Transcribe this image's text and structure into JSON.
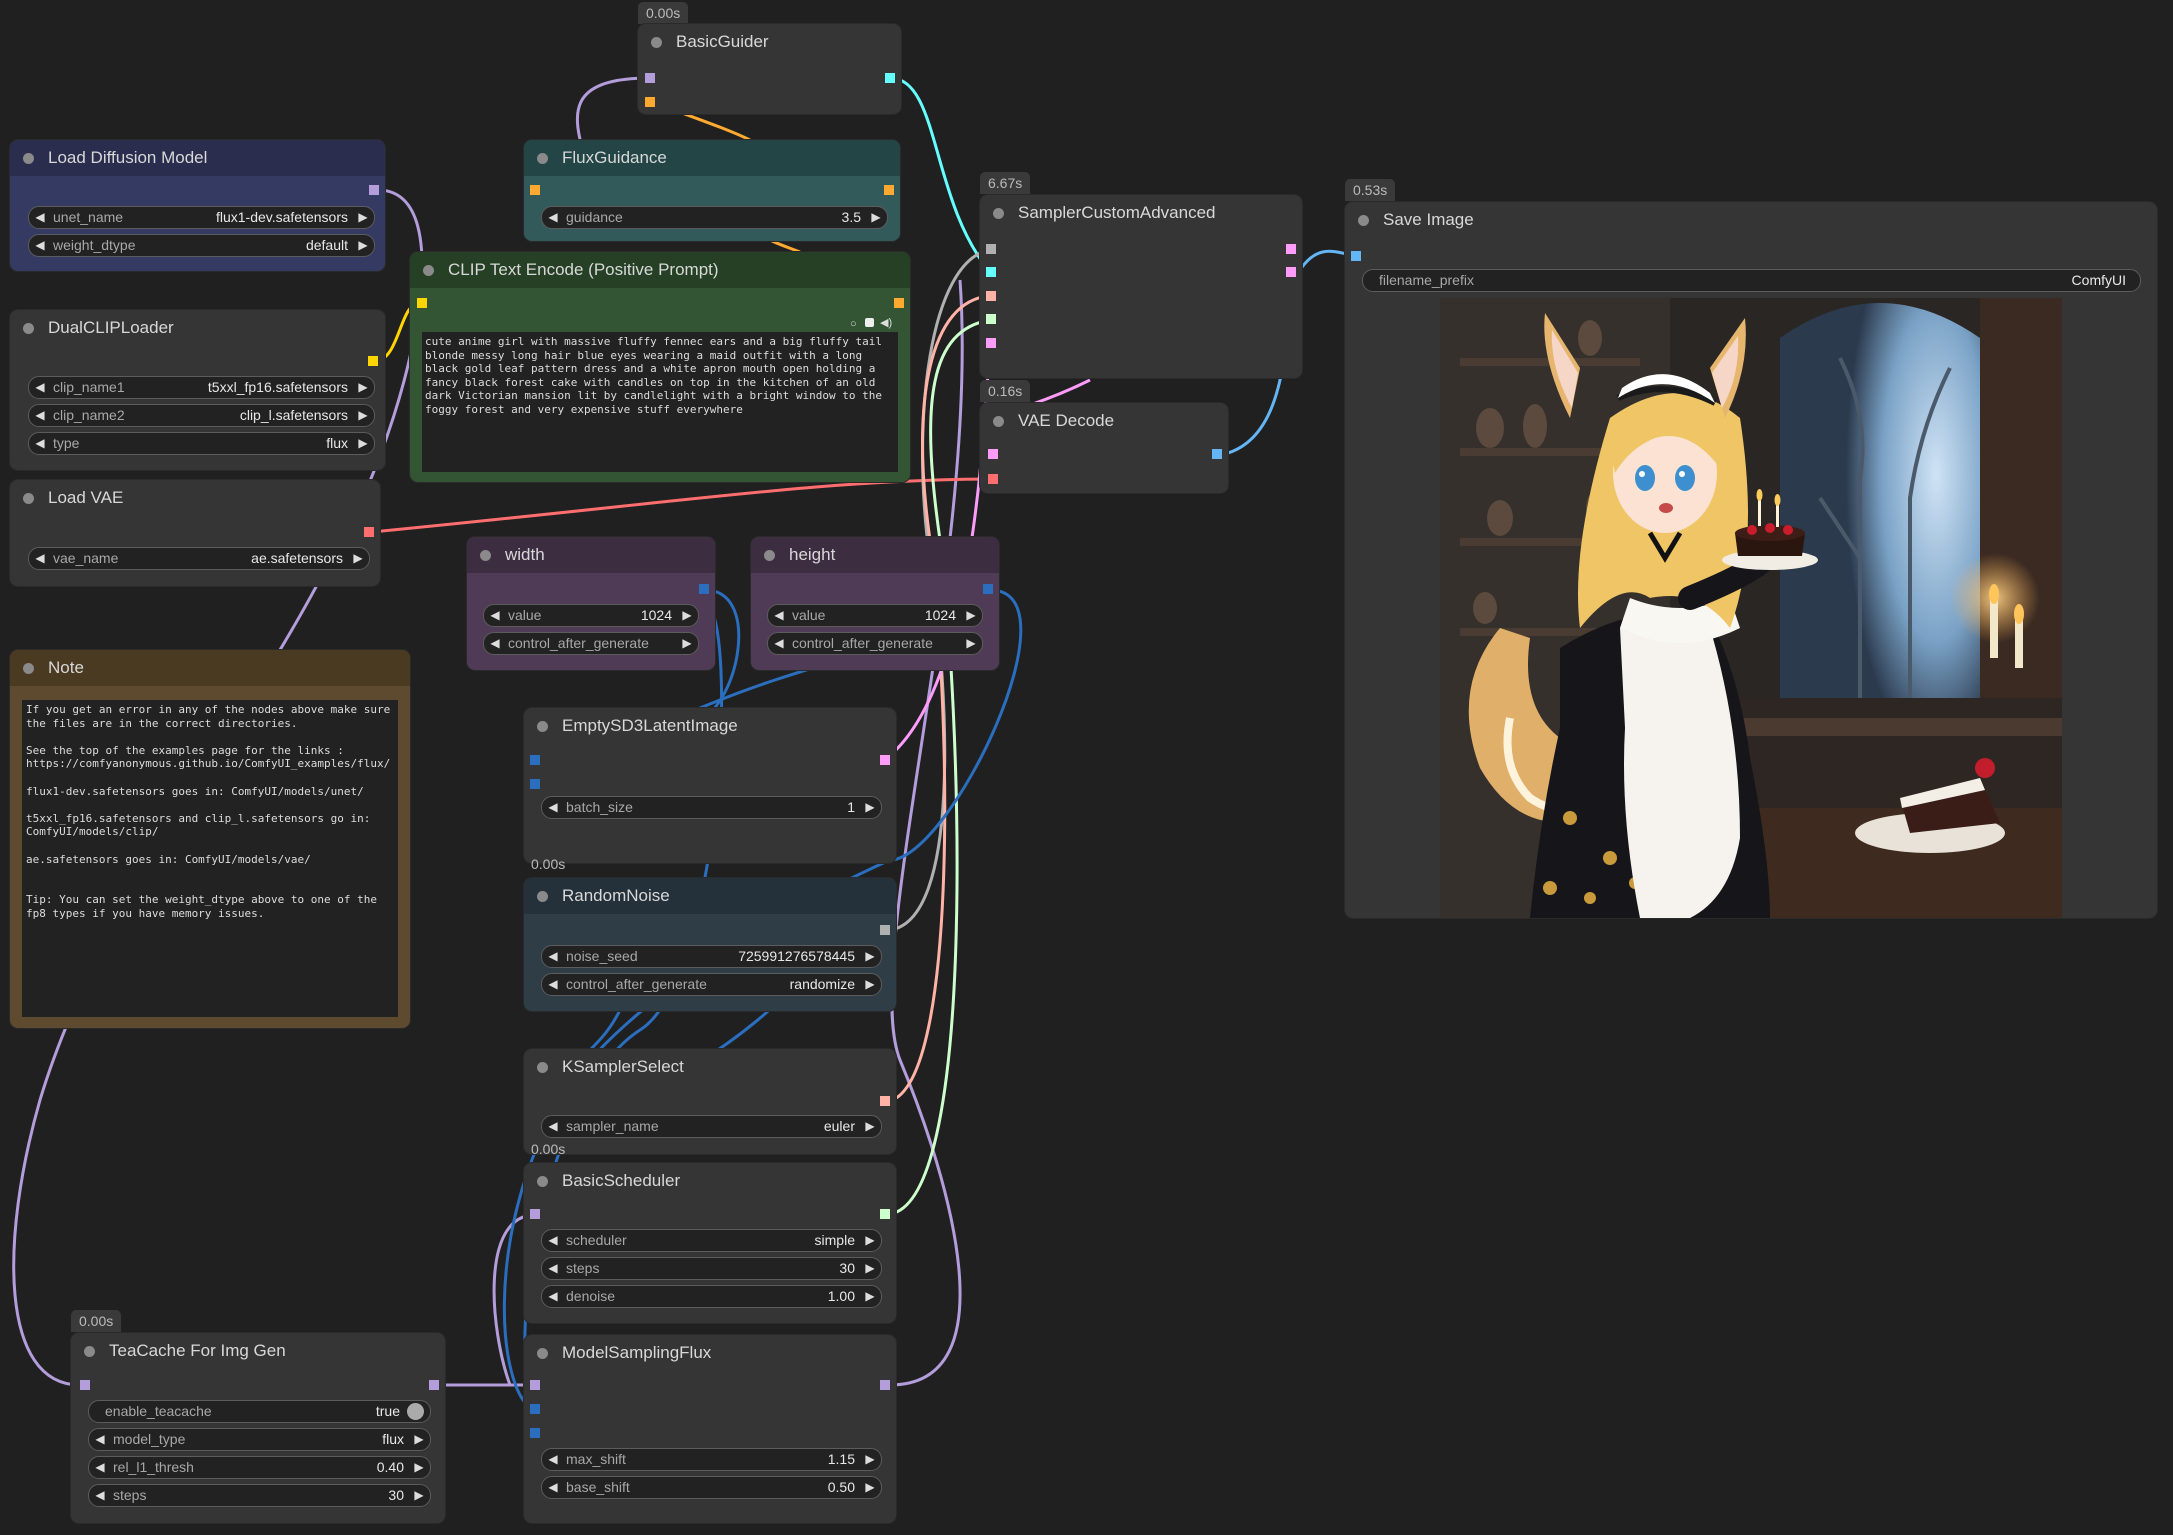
{
  "colors": {
    "canvas": "#202020",
    "model_port": "#b39ddb",
    "clip_port": "#ffd500",
    "conditioning_port": "#ffa931",
    "vae_port": "#ff6e6e",
    "latent_port": "#ff9cf9",
    "image_port": "#64b5f6",
    "int_port": "#2a6ebd",
    "guider_port": "#66ffff",
    "noise_port": "#b0b0b0",
    "sampler_port": "#ffb3a7",
    "sigmas_port": "#cdffcd"
  },
  "nodes": {
    "basic_guider": {
      "title": "BasicGuider",
      "time": "0.00s"
    },
    "load_diffusion_model": {
      "title": "Load Diffusion Model",
      "unet_name": {
        "label": "unet_name",
        "value": "flux1-dev.safetensors"
      },
      "weight_dtype": {
        "label": "weight_dtype",
        "value": "default"
      }
    },
    "flux_guidance": {
      "title": "FluxGuidance",
      "guidance": {
        "label": "guidance",
        "value": "3.5"
      }
    },
    "sampler_custom_advanced": {
      "title": "SamplerCustomAdvanced",
      "time": "6.67s"
    },
    "save_image": {
      "title": "Save Image",
      "time": "0.53s",
      "filename_prefix": {
        "label": "filename_prefix",
        "value": "ComfyUI"
      },
      "image_description": "anime fennec fox girl in maid outfit holding a birthday cake"
    },
    "dual_clip_loader": {
      "title": "DualCLIPLoader",
      "clip_name1": {
        "label": "clip_name1",
        "value": "t5xxl_fp16.safetensors"
      },
      "clip_name2": {
        "label": "clip_name2",
        "value": "clip_l.safetensors"
      },
      "type": {
        "label": "type",
        "value": "flux"
      }
    },
    "clip_text_encode": {
      "title": "CLIP Text Encode (Positive Prompt)",
      "text": "cute anime girl with massive fluffy fennec ears and a big fluffy tail blonde messy long hair blue eyes wearing a maid outfit with a long black gold leaf pattern dress and a white apron mouth open holding a fancy black forest cake with candles on top in the kitchen of an old dark Victorian mansion lit by candlelight with a bright window to the foggy forest and very expensive stuff everywhere"
    },
    "vae_decode": {
      "title": "VAE Decode",
      "time": "0.16s"
    },
    "load_vae": {
      "title": "Load VAE",
      "vae_name": {
        "label": "vae_name",
        "value": "ae.safetensors"
      }
    },
    "width": {
      "title": "width",
      "value": {
        "label": "value",
        "value": "1024"
      },
      "control": {
        "label": "control_after_generate",
        "value": ""
      }
    },
    "height": {
      "title": "height",
      "value": {
        "label": "value",
        "value": "1024"
      },
      "control": {
        "label": "control_after_generate",
        "value": ""
      }
    },
    "note": {
      "title": "Note",
      "text": "If you get an error in any of the nodes above make sure the files are in the correct directories.\n\nSee the top of the examples page for the links : https://comfyanonymous.github.io/ComfyUI_examples/flux/\n\nflux1-dev.safetensors goes in: ComfyUI/models/unet/\n\nt5xxl_fp16.safetensors and clip_l.safetensors go in: ComfyUI/models/clip/\n\nae.safetensors goes in: ComfyUI/models/vae/\n\n\nTip: You can set the weight_dtype above to one of the fp8 types if you have memory issues."
    },
    "empty_latent": {
      "title": "EmptySD3LatentImage",
      "time": "0.00s",
      "batch_size": {
        "label": "batch_size",
        "value": "1"
      }
    },
    "random_noise": {
      "title": "RandomNoise",
      "noise_seed": {
        "label": "noise_seed",
        "value": "725991276578445"
      },
      "control": {
        "label": "control_after_generate",
        "value": "randomize"
      }
    },
    "ksampler_select": {
      "title": "KSamplerSelect",
      "time": "0.00s",
      "sampler_name": {
        "label": "sampler_name",
        "value": "euler"
      }
    },
    "basic_scheduler": {
      "title": "BasicScheduler",
      "scheduler": {
        "label": "scheduler",
        "value": "simple"
      },
      "steps": {
        "label": "steps",
        "value": "30"
      },
      "denoise": {
        "label": "denoise",
        "value": "1.00"
      }
    },
    "teacache": {
      "title": "TeaCache For Img Gen",
      "time": "0.00s",
      "enable_teacache": {
        "label": "enable_teacache",
        "value": "true"
      },
      "model_type": {
        "label": "model_type",
        "value": "flux"
      },
      "rel_l1_thresh": {
        "label": "rel_l1_thresh",
        "value": "0.40"
      },
      "steps": {
        "label": "steps",
        "value": "30"
      }
    },
    "model_sampling_flux": {
      "title": "ModelSamplingFlux",
      "max_shift": {
        "label": "max_shift",
        "value": "1.15"
      },
      "base_shift": {
        "label": "base_shift",
        "value": "0.50"
      }
    }
  }
}
